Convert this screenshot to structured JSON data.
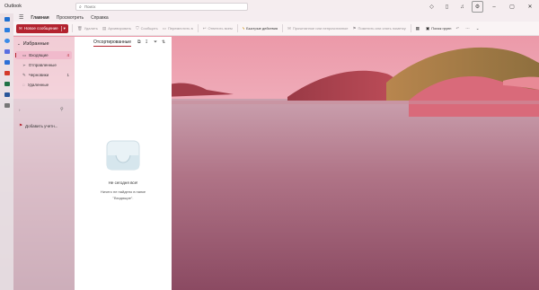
{
  "app": {
    "title": "Outlook"
  },
  "search": {
    "placeholder": "Поиск"
  },
  "titlebar_icons": [
    "diamond-icon",
    "notes-icon",
    "bell-icon",
    "settings-icon"
  ],
  "tabs": [
    {
      "label": "Главная",
      "active": true
    },
    {
      "label": "Просмотреть",
      "active": false
    },
    {
      "label": "Справка",
      "active": false
    }
  ],
  "ribbon": {
    "new_mail_label": "Новое сообщение",
    "delete_label": "Удалить",
    "archive_label": "Архивировать",
    "report_label": "Сообщить",
    "move_label": "Переместить в",
    "reply_all_label": "Ответить всем",
    "quick_steps_label": "Быстрые действия",
    "mark_read_label": "Прочитанное или непрочитанное",
    "flag_label": "Пометить или снять пометку",
    "group_search_label": "Поиск групп"
  },
  "folders": {
    "favorites_label": "Избранные",
    "items": [
      {
        "label": "Входящие",
        "count": "4",
        "selected": true,
        "icon": "inbox-icon"
      },
      {
        "label": "Отправленные",
        "count": "",
        "selected": false,
        "icon": "sent-icon"
      },
      {
        "label": "Черновики",
        "count": "1",
        "selected": false,
        "icon": "drafts-icon"
      },
      {
        "label": "Удаленные",
        "count": "",
        "selected": false,
        "icon": "trash-icon"
      }
    ],
    "add_account_label": "Добавить учетн..."
  },
  "message_list": {
    "sort_label": "Отсортированные",
    "empty_title": "Не сегодня все!",
    "empty_line1": "Ничего не найдено в папке",
    "empty_line2": "\"Входящие\"."
  },
  "colors": {
    "accent": "#b3232f",
    "sky_top": "#ef9aa7",
    "sky_bottom": "#f4d1d6",
    "water": "#b56a82"
  }
}
